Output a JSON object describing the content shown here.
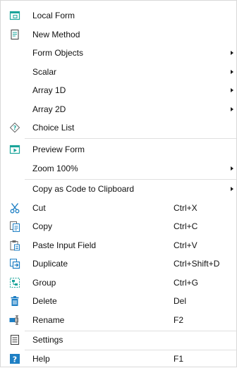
{
  "menu": {
    "items": [
      {
        "label": "Local Form",
        "shortcut": "",
        "icon": "local-form-icon"
      },
      {
        "label": "New Method",
        "shortcut": "",
        "icon": "new-method-icon"
      },
      {
        "label": "Form Objects",
        "shortcut": "",
        "icon": ""
      },
      {
        "label": "Scalar",
        "shortcut": "",
        "icon": ""
      },
      {
        "label": "Array 1D",
        "shortcut": "",
        "icon": ""
      },
      {
        "label": "Array 2D",
        "shortcut": "",
        "icon": ""
      },
      {
        "label": "Choice List",
        "shortcut": "",
        "icon": "choice-list-icon"
      },
      {
        "label": "Preview Form",
        "shortcut": "",
        "icon": "preview-form-icon"
      },
      {
        "label": "Zoom 100%",
        "shortcut": "",
        "icon": ""
      },
      {
        "label": "Copy as Code to Clipboard",
        "shortcut": "",
        "icon": ""
      },
      {
        "label": "Cut",
        "shortcut": "Ctrl+X",
        "icon": "scissors-icon"
      },
      {
        "label": "Copy",
        "shortcut": "Ctrl+C",
        "icon": "copy-icon"
      },
      {
        "label": "Paste Input Field",
        "shortcut": "Ctrl+V",
        "icon": "paste-icon"
      },
      {
        "label": "Duplicate",
        "shortcut": "Ctrl+Shift+D",
        "icon": "duplicate-icon"
      },
      {
        "label": "Group",
        "shortcut": "Ctrl+G",
        "icon": "group-icon"
      },
      {
        "label": "Delete",
        "shortcut": "Del",
        "icon": "trash-icon"
      },
      {
        "label": "Rename",
        "shortcut": "F2",
        "icon": "rename-icon"
      },
      {
        "label": "Settings",
        "shortcut": "",
        "icon": "settings-icon"
      },
      {
        "label": "Help",
        "shortcut": "F1",
        "icon": "help-icon"
      }
    ]
  },
  "colors": {
    "accent": "#1e7fc4",
    "separator": "#e0e0e0",
    "text": "#111111"
  }
}
